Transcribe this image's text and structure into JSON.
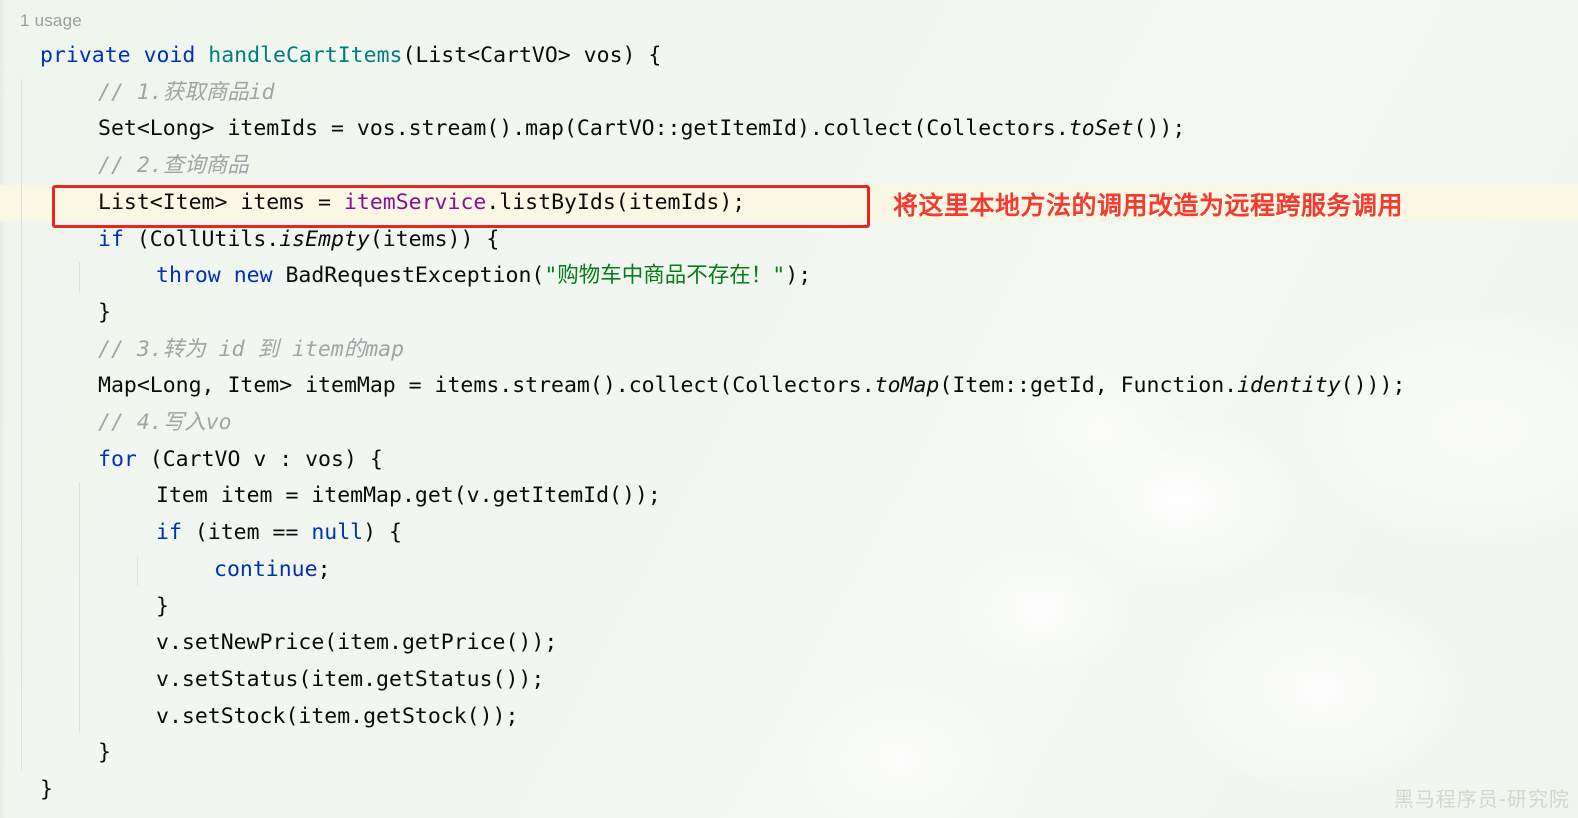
{
  "editor": {
    "usage_label": "1 usage",
    "language": "java",
    "background_color": "#f2f6f0",
    "highlight_row_color": "#faf7e4",
    "callout_border_color": "#e8271a",
    "colors": {
      "keyword": "#0033b3",
      "method_declaration": "#00807c",
      "field": "#871094",
      "string": "#067d17",
      "comment": "#a0a4a6",
      "default_text": "#0b0b0b",
      "annotation": "#f43b2e"
    }
  },
  "code": {
    "lines": [
      {
        "id": "line-method-signature",
        "indent": 0,
        "highlighted": false,
        "tokens": [
          {
            "t": "private",
            "c": "kw"
          },
          {
            "t": " ",
            "c": "plain"
          },
          {
            "t": "void",
            "c": "kw"
          },
          {
            "t": " ",
            "c": "plain"
          },
          {
            "t": "handleCartItems",
            "c": "mth"
          },
          {
            "t": "(List<CartVO> vos) {",
            "c": "plain"
          }
        ]
      },
      {
        "id": "line-comment-1",
        "indent": 1,
        "highlighted": false,
        "tokens": [
          {
            "t": "// 1.获取商品id",
            "c": "cmt"
          }
        ]
      },
      {
        "id": "line-item-ids",
        "indent": 1,
        "highlighted": false,
        "tokens": [
          {
            "t": "Set<Long> itemIds = vos.stream().map(CartVO::getItemId).collect(Collectors.",
            "c": "plain"
          },
          {
            "t": "toSet",
            "c": "stat"
          },
          {
            "t": "());",
            "c": "plain"
          }
        ]
      },
      {
        "id": "line-comment-2",
        "indent": 1,
        "highlighted": false,
        "tokens": [
          {
            "t": "// 2.查询商品",
            "c": "cmt"
          }
        ]
      },
      {
        "id": "line-list-by-ids",
        "indent": 1,
        "highlighted": true,
        "tokens": [
          {
            "t": "List<Item> items = ",
            "c": "plain"
          },
          {
            "t": "itemService",
            "c": "fld"
          },
          {
            "t": ".listByIds(itemIds);",
            "c": "plain"
          }
        ]
      },
      {
        "id": "line-if-empty",
        "indent": 1,
        "highlighted": false,
        "tokens": [
          {
            "t": "if",
            "c": "kw"
          },
          {
            "t": " (CollUtils.",
            "c": "plain"
          },
          {
            "t": "isEmpty",
            "c": "stat"
          },
          {
            "t": "(items)) {",
            "c": "plain"
          }
        ]
      },
      {
        "id": "line-throw",
        "indent": 2,
        "highlighted": false,
        "tokens": [
          {
            "t": "throw",
            "c": "kw"
          },
          {
            "t": " ",
            "c": "plain"
          },
          {
            "t": "new",
            "c": "kw"
          },
          {
            "t": " BadRequestException(",
            "c": "plain"
          },
          {
            "t": "\"购物车中商品不存在！\"",
            "c": "str"
          },
          {
            "t": ");",
            "c": "plain"
          }
        ]
      },
      {
        "id": "line-close-if",
        "indent": 1,
        "highlighted": false,
        "tokens": [
          {
            "t": "}",
            "c": "plain"
          }
        ]
      },
      {
        "id": "line-comment-3",
        "indent": 1,
        "highlighted": false,
        "tokens": [
          {
            "t": "// 3.转为 id 到 item的map",
            "c": "cmt"
          }
        ]
      },
      {
        "id": "line-item-map",
        "indent": 1,
        "highlighted": false,
        "tokens": [
          {
            "t": "Map<Long, Item> itemMap = items.stream().collect(Collectors.",
            "c": "plain"
          },
          {
            "t": "toMap",
            "c": "stat"
          },
          {
            "t": "(Item::getId, Function.",
            "c": "plain"
          },
          {
            "t": "identity",
            "c": "stat"
          },
          {
            "t": "()));",
            "c": "plain"
          }
        ]
      },
      {
        "id": "line-comment-4",
        "indent": 1,
        "highlighted": false,
        "tokens": [
          {
            "t": "// 4.写入vo",
            "c": "cmt"
          }
        ]
      },
      {
        "id": "line-for",
        "indent": 1,
        "highlighted": false,
        "tokens": [
          {
            "t": "for",
            "c": "kw"
          },
          {
            "t": " (CartVO v : vos) {",
            "c": "plain"
          }
        ]
      },
      {
        "id": "line-item-get",
        "indent": 2,
        "highlighted": false,
        "tokens": [
          {
            "t": "Item item = itemMap.get(v.getItemId());",
            "c": "plain"
          }
        ]
      },
      {
        "id": "line-if-null",
        "indent": 2,
        "highlighted": false,
        "tokens": [
          {
            "t": "if",
            "c": "kw"
          },
          {
            "t": " (item == ",
            "c": "plain"
          },
          {
            "t": "null",
            "c": "kw"
          },
          {
            "t": ") {",
            "c": "plain"
          }
        ]
      },
      {
        "id": "line-continue",
        "indent": 3,
        "highlighted": false,
        "tokens": [
          {
            "t": "continue",
            "c": "kw"
          },
          {
            "t": ";",
            "c": "plain"
          }
        ]
      },
      {
        "id": "line-close-if-null",
        "indent": 2,
        "highlighted": false,
        "tokens": [
          {
            "t": "}",
            "c": "plain"
          }
        ]
      },
      {
        "id": "line-set-new-price",
        "indent": 2,
        "highlighted": false,
        "tokens": [
          {
            "t": "v.setNewPrice(item.getPrice());",
            "c": "plain"
          }
        ]
      },
      {
        "id": "line-set-status",
        "indent": 2,
        "highlighted": false,
        "tokens": [
          {
            "t": "v.setStatus(item.getStatus());",
            "c": "plain"
          }
        ]
      },
      {
        "id": "line-set-stock",
        "indent": 2,
        "highlighted": false,
        "tokens": [
          {
            "t": "v.setStock(item.getStock());",
            "c": "plain"
          }
        ]
      },
      {
        "id": "line-close-for",
        "indent": 1,
        "highlighted": false,
        "tokens": [
          {
            "t": "}",
            "c": "plain"
          }
        ]
      },
      {
        "id": "line-close-method",
        "indent": 0,
        "highlighted": false,
        "tokens": [
          {
            "t": "}",
            "c": "plain"
          }
        ]
      }
    ]
  },
  "annotation": {
    "text": "将这里本地方法的调用改造为远程跨服务调用"
  },
  "watermark": {
    "text": "黑马程序员-研究院"
  }
}
